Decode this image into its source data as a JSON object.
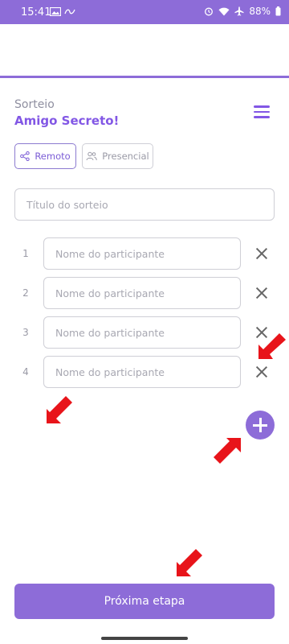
{
  "status_bar": {
    "time": "15:41",
    "battery": "88%"
  },
  "header": {
    "subtitle": "Sorteio",
    "title": "Amigo Secreto!"
  },
  "modes": [
    {
      "label": "Remoto",
      "icon": "share-icon",
      "active": true
    },
    {
      "label": "Presencial",
      "icon": "people-icon",
      "active": false
    }
  ],
  "title_input": {
    "placeholder": "Título do sorteio",
    "value": ""
  },
  "participants": [
    {
      "number": "1",
      "placeholder": "Nome do participante",
      "value": ""
    },
    {
      "number": "2",
      "placeholder": "Nome do participante",
      "value": ""
    },
    {
      "number": "3",
      "placeholder": "Nome do participante",
      "value": ""
    },
    {
      "number": "4",
      "placeholder": "Nome do participante",
      "value": ""
    }
  ],
  "next_button": {
    "label": "Próxima etapa"
  },
  "colors": {
    "accent": "#8d6cd8",
    "title": "#8257e5",
    "annotation_arrow": "#e8141a"
  }
}
